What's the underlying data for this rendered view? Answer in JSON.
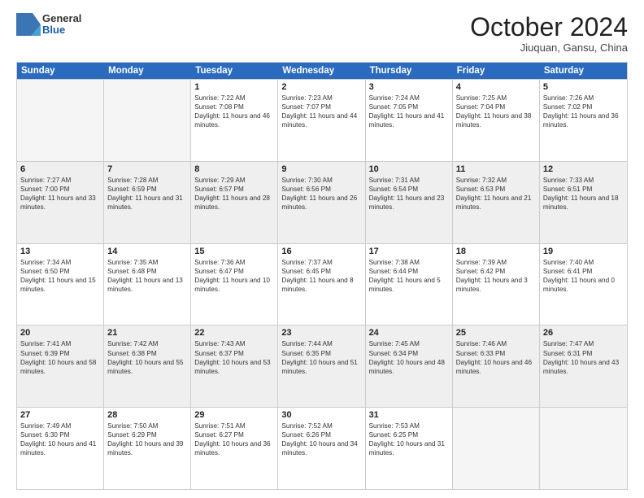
{
  "logo": {
    "general": "General",
    "blue": "Blue"
  },
  "title": "October 2024",
  "location": "Jiuquan, Gansu, China",
  "header_days": [
    "Sunday",
    "Monday",
    "Tuesday",
    "Wednesday",
    "Thursday",
    "Friday",
    "Saturday"
  ],
  "weeks": [
    [
      {
        "day": "",
        "sunrise": "",
        "sunset": "",
        "daylight": "",
        "shaded": false,
        "empty": true
      },
      {
        "day": "",
        "sunrise": "",
        "sunset": "",
        "daylight": "",
        "shaded": false,
        "empty": true
      },
      {
        "day": "1",
        "sunrise": "Sunrise: 7:22 AM",
        "sunset": "Sunset: 7:08 PM",
        "daylight": "Daylight: 11 hours and 46 minutes.",
        "shaded": false,
        "empty": false
      },
      {
        "day": "2",
        "sunrise": "Sunrise: 7:23 AM",
        "sunset": "Sunset: 7:07 PM",
        "daylight": "Daylight: 11 hours and 44 minutes.",
        "shaded": false,
        "empty": false
      },
      {
        "day": "3",
        "sunrise": "Sunrise: 7:24 AM",
        "sunset": "Sunset: 7:05 PM",
        "daylight": "Daylight: 11 hours and 41 minutes.",
        "shaded": false,
        "empty": false
      },
      {
        "day": "4",
        "sunrise": "Sunrise: 7:25 AM",
        "sunset": "Sunset: 7:04 PM",
        "daylight": "Daylight: 11 hours and 38 minutes.",
        "shaded": false,
        "empty": false
      },
      {
        "day": "5",
        "sunrise": "Sunrise: 7:26 AM",
        "sunset": "Sunset: 7:02 PM",
        "daylight": "Daylight: 11 hours and 36 minutes.",
        "shaded": false,
        "empty": false
      }
    ],
    [
      {
        "day": "6",
        "sunrise": "Sunrise: 7:27 AM",
        "sunset": "Sunset: 7:00 PM",
        "daylight": "Daylight: 11 hours and 33 minutes.",
        "shaded": true,
        "empty": false
      },
      {
        "day": "7",
        "sunrise": "Sunrise: 7:28 AM",
        "sunset": "Sunset: 6:59 PM",
        "daylight": "Daylight: 11 hours and 31 minutes.",
        "shaded": true,
        "empty": false
      },
      {
        "day": "8",
        "sunrise": "Sunrise: 7:29 AM",
        "sunset": "Sunset: 6:57 PM",
        "daylight": "Daylight: 11 hours and 28 minutes.",
        "shaded": true,
        "empty": false
      },
      {
        "day": "9",
        "sunrise": "Sunrise: 7:30 AM",
        "sunset": "Sunset: 6:56 PM",
        "daylight": "Daylight: 11 hours and 26 minutes.",
        "shaded": true,
        "empty": false
      },
      {
        "day": "10",
        "sunrise": "Sunrise: 7:31 AM",
        "sunset": "Sunset: 6:54 PM",
        "daylight": "Daylight: 11 hours and 23 minutes.",
        "shaded": true,
        "empty": false
      },
      {
        "day": "11",
        "sunrise": "Sunrise: 7:32 AM",
        "sunset": "Sunset: 6:53 PM",
        "daylight": "Daylight: 11 hours and 21 minutes.",
        "shaded": true,
        "empty": false
      },
      {
        "day": "12",
        "sunrise": "Sunrise: 7:33 AM",
        "sunset": "Sunset: 6:51 PM",
        "daylight": "Daylight: 11 hours and 18 minutes.",
        "shaded": true,
        "empty": false
      }
    ],
    [
      {
        "day": "13",
        "sunrise": "Sunrise: 7:34 AM",
        "sunset": "Sunset: 6:50 PM",
        "daylight": "Daylight: 11 hours and 15 minutes.",
        "shaded": false,
        "empty": false
      },
      {
        "day": "14",
        "sunrise": "Sunrise: 7:35 AM",
        "sunset": "Sunset: 6:48 PM",
        "daylight": "Daylight: 11 hours and 13 minutes.",
        "shaded": false,
        "empty": false
      },
      {
        "day": "15",
        "sunrise": "Sunrise: 7:36 AM",
        "sunset": "Sunset: 6:47 PM",
        "daylight": "Daylight: 11 hours and 10 minutes.",
        "shaded": false,
        "empty": false
      },
      {
        "day": "16",
        "sunrise": "Sunrise: 7:37 AM",
        "sunset": "Sunset: 6:45 PM",
        "daylight": "Daylight: 11 hours and 8 minutes.",
        "shaded": false,
        "empty": false
      },
      {
        "day": "17",
        "sunrise": "Sunrise: 7:38 AM",
        "sunset": "Sunset: 6:44 PM",
        "daylight": "Daylight: 11 hours and 5 minutes.",
        "shaded": false,
        "empty": false
      },
      {
        "day": "18",
        "sunrise": "Sunrise: 7:39 AM",
        "sunset": "Sunset: 6:42 PM",
        "daylight": "Daylight: 11 hours and 3 minutes.",
        "shaded": false,
        "empty": false
      },
      {
        "day": "19",
        "sunrise": "Sunrise: 7:40 AM",
        "sunset": "Sunset: 6:41 PM",
        "daylight": "Daylight: 11 hours and 0 minutes.",
        "shaded": false,
        "empty": false
      }
    ],
    [
      {
        "day": "20",
        "sunrise": "Sunrise: 7:41 AM",
        "sunset": "Sunset: 6:39 PM",
        "daylight": "Daylight: 10 hours and 58 minutes.",
        "shaded": true,
        "empty": false
      },
      {
        "day": "21",
        "sunrise": "Sunrise: 7:42 AM",
        "sunset": "Sunset: 6:38 PM",
        "daylight": "Daylight: 10 hours and 55 minutes.",
        "shaded": true,
        "empty": false
      },
      {
        "day": "22",
        "sunrise": "Sunrise: 7:43 AM",
        "sunset": "Sunset: 6:37 PM",
        "daylight": "Daylight: 10 hours and 53 minutes.",
        "shaded": true,
        "empty": false
      },
      {
        "day": "23",
        "sunrise": "Sunrise: 7:44 AM",
        "sunset": "Sunset: 6:35 PM",
        "daylight": "Daylight: 10 hours and 51 minutes.",
        "shaded": true,
        "empty": false
      },
      {
        "day": "24",
        "sunrise": "Sunrise: 7:45 AM",
        "sunset": "Sunset: 6:34 PM",
        "daylight": "Daylight: 10 hours and 48 minutes.",
        "shaded": true,
        "empty": false
      },
      {
        "day": "25",
        "sunrise": "Sunrise: 7:46 AM",
        "sunset": "Sunset: 6:33 PM",
        "daylight": "Daylight: 10 hours and 46 minutes.",
        "shaded": true,
        "empty": false
      },
      {
        "day": "26",
        "sunrise": "Sunrise: 7:47 AM",
        "sunset": "Sunset: 6:31 PM",
        "daylight": "Daylight: 10 hours and 43 minutes.",
        "shaded": true,
        "empty": false
      }
    ],
    [
      {
        "day": "27",
        "sunrise": "Sunrise: 7:49 AM",
        "sunset": "Sunset: 6:30 PM",
        "daylight": "Daylight: 10 hours and 41 minutes.",
        "shaded": false,
        "empty": false
      },
      {
        "day": "28",
        "sunrise": "Sunrise: 7:50 AM",
        "sunset": "Sunset: 6:29 PM",
        "daylight": "Daylight: 10 hours and 39 minutes.",
        "shaded": false,
        "empty": false
      },
      {
        "day": "29",
        "sunrise": "Sunrise: 7:51 AM",
        "sunset": "Sunset: 6:27 PM",
        "daylight": "Daylight: 10 hours and 36 minutes.",
        "shaded": false,
        "empty": false
      },
      {
        "day": "30",
        "sunrise": "Sunrise: 7:52 AM",
        "sunset": "Sunset: 6:26 PM",
        "daylight": "Daylight: 10 hours and 34 minutes.",
        "shaded": false,
        "empty": false
      },
      {
        "day": "31",
        "sunrise": "Sunrise: 7:53 AM",
        "sunset": "Sunset: 6:25 PM",
        "daylight": "Daylight: 10 hours and 31 minutes.",
        "shaded": false,
        "empty": false
      },
      {
        "day": "",
        "sunrise": "",
        "sunset": "",
        "daylight": "",
        "shaded": false,
        "empty": true
      },
      {
        "day": "",
        "sunrise": "",
        "sunset": "",
        "daylight": "",
        "shaded": false,
        "empty": true
      }
    ]
  ]
}
